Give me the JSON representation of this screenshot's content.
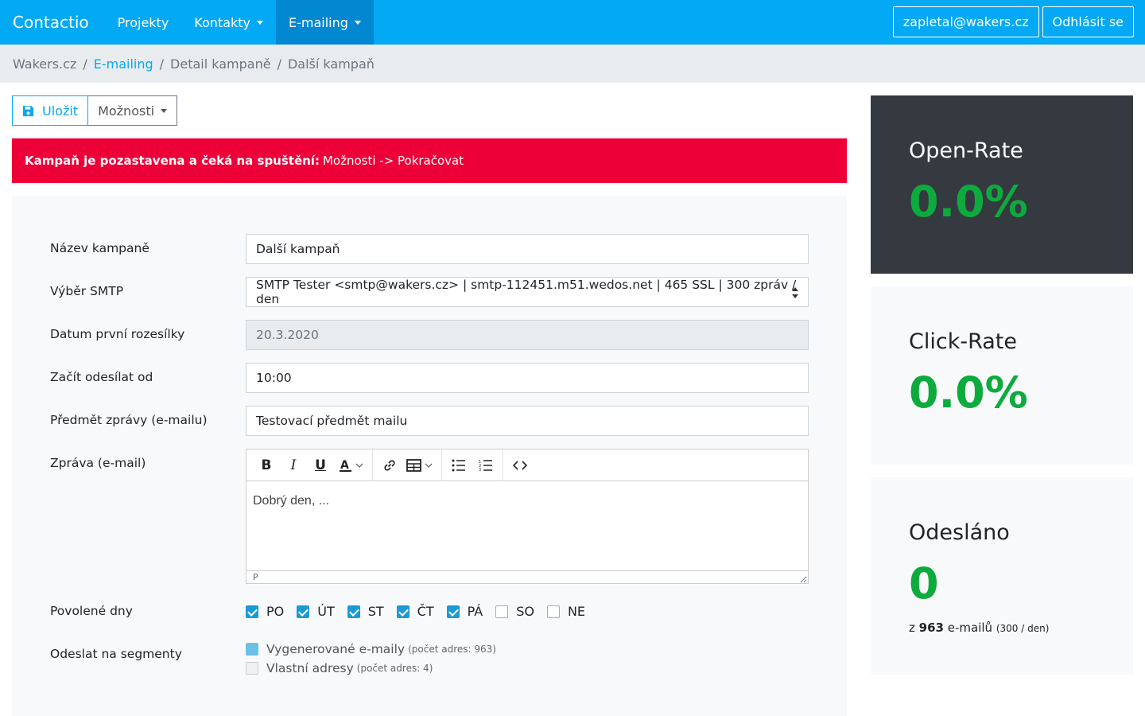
{
  "nav": {
    "brand": "Contactio",
    "items": [
      {
        "label": "Projekty"
      },
      {
        "label": "Kontakty"
      },
      {
        "label": "E-mailing"
      }
    ],
    "user": "zapletal@wakers.cz",
    "logout": "Odhlásit se"
  },
  "breadcrumb": [
    "Wakers.cz",
    "E-mailing",
    "Detail kampaně",
    "Další kampaň"
  ],
  "toolbar": {
    "save": "Uložit",
    "options": "Možnosti"
  },
  "alert": {
    "bold": "Kampaň je pozastavena a čeká na spuštění:",
    "text": "Možnosti -> Pokračovat"
  },
  "form": {
    "name_label": "Název kampaně",
    "name_value": "Další kampaň",
    "smtp_label": "Výběr SMTP",
    "smtp_value": "SMTP Tester <smtp@wakers.cz> | smtp-112451.m51.wedos.net | 465 SSL | 300 zpráv / den",
    "date_label": "Datum první rozesílky",
    "date_value": "20.3.2020",
    "start_label": "Začít odesílat od",
    "start_value": "10:00",
    "subject_label": "Předmět zprávy (e-mailu)",
    "subject_value": "Testovací předmět mailu",
    "message_label": "Zpráva (e-mail)",
    "message_body": "Dobrý den, ...",
    "editor_status": "P",
    "days_label": "Povolené dny",
    "days": [
      {
        "label": "PO",
        "checked": true
      },
      {
        "label": "ÚT",
        "checked": true
      },
      {
        "label": "ST",
        "checked": true
      },
      {
        "label": "ČT",
        "checked": true
      },
      {
        "label": "PÁ",
        "checked": true
      },
      {
        "label": "SO",
        "checked": false
      },
      {
        "label": "NE",
        "checked": false
      }
    ],
    "segments_label": "Odeslat na segmenty",
    "segments": [
      {
        "label": "Vygenerované e-maily",
        "note": "(počet adres: 963)",
        "checked": true
      },
      {
        "label": "Vlastní adresy",
        "note": "(počet adres: 4)",
        "checked": false
      }
    ]
  },
  "stats": {
    "open_title": "Open-Rate",
    "open_value": "0.0%",
    "click_title": "Click-Rate",
    "click_value": "0.0%",
    "sent_title": "Odesláno",
    "sent_value": "0",
    "sent_sub_prefix": "z",
    "sent_total": "963",
    "sent_sub_suffix": "e-mailů",
    "sent_rate": "(300 / den)"
  },
  "colors": {
    "primary": "#03a9f4",
    "alert": "#ed0037",
    "success": "#0dab3d",
    "dark_card": "#343a40"
  }
}
